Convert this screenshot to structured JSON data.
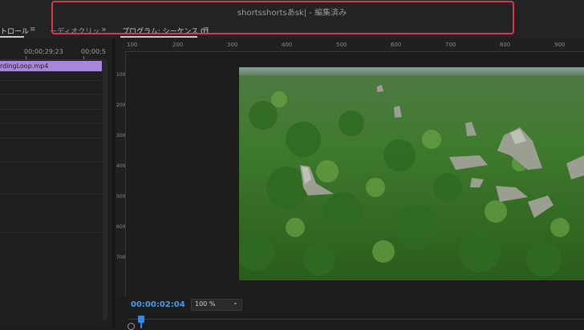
{
  "titlebar": {
    "title": "shortsshortsあsk| - 編集済み"
  },
  "tabs": {
    "effect_controls": "トロール",
    "audio_clip_mixer": "ーディオクリッ",
    "overflow": "»",
    "program": "プログラム: シーケンス 01",
    "menu_icon": "≡"
  },
  "source": {
    "ruler_time_1": "00;00;29;23",
    "ruler_time_2": "00;00;5",
    "clip_name": "rdingLoop.mp4"
  },
  "program": {
    "ruler_numbers": [
      "100",
      "200",
      "300",
      "400",
      "500",
      "600",
      "700",
      "800",
      "900"
    ],
    "vruler_numbers": [
      "100",
      "200",
      "300",
      "400",
      "500",
      "600",
      "700"
    ],
    "timecode": "00:00:02:04",
    "zoom": "100 %"
  },
  "colors": {
    "accent": "#3a86e6",
    "clip": "#a887d8",
    "highlight": "#d9374b"
  }
}
